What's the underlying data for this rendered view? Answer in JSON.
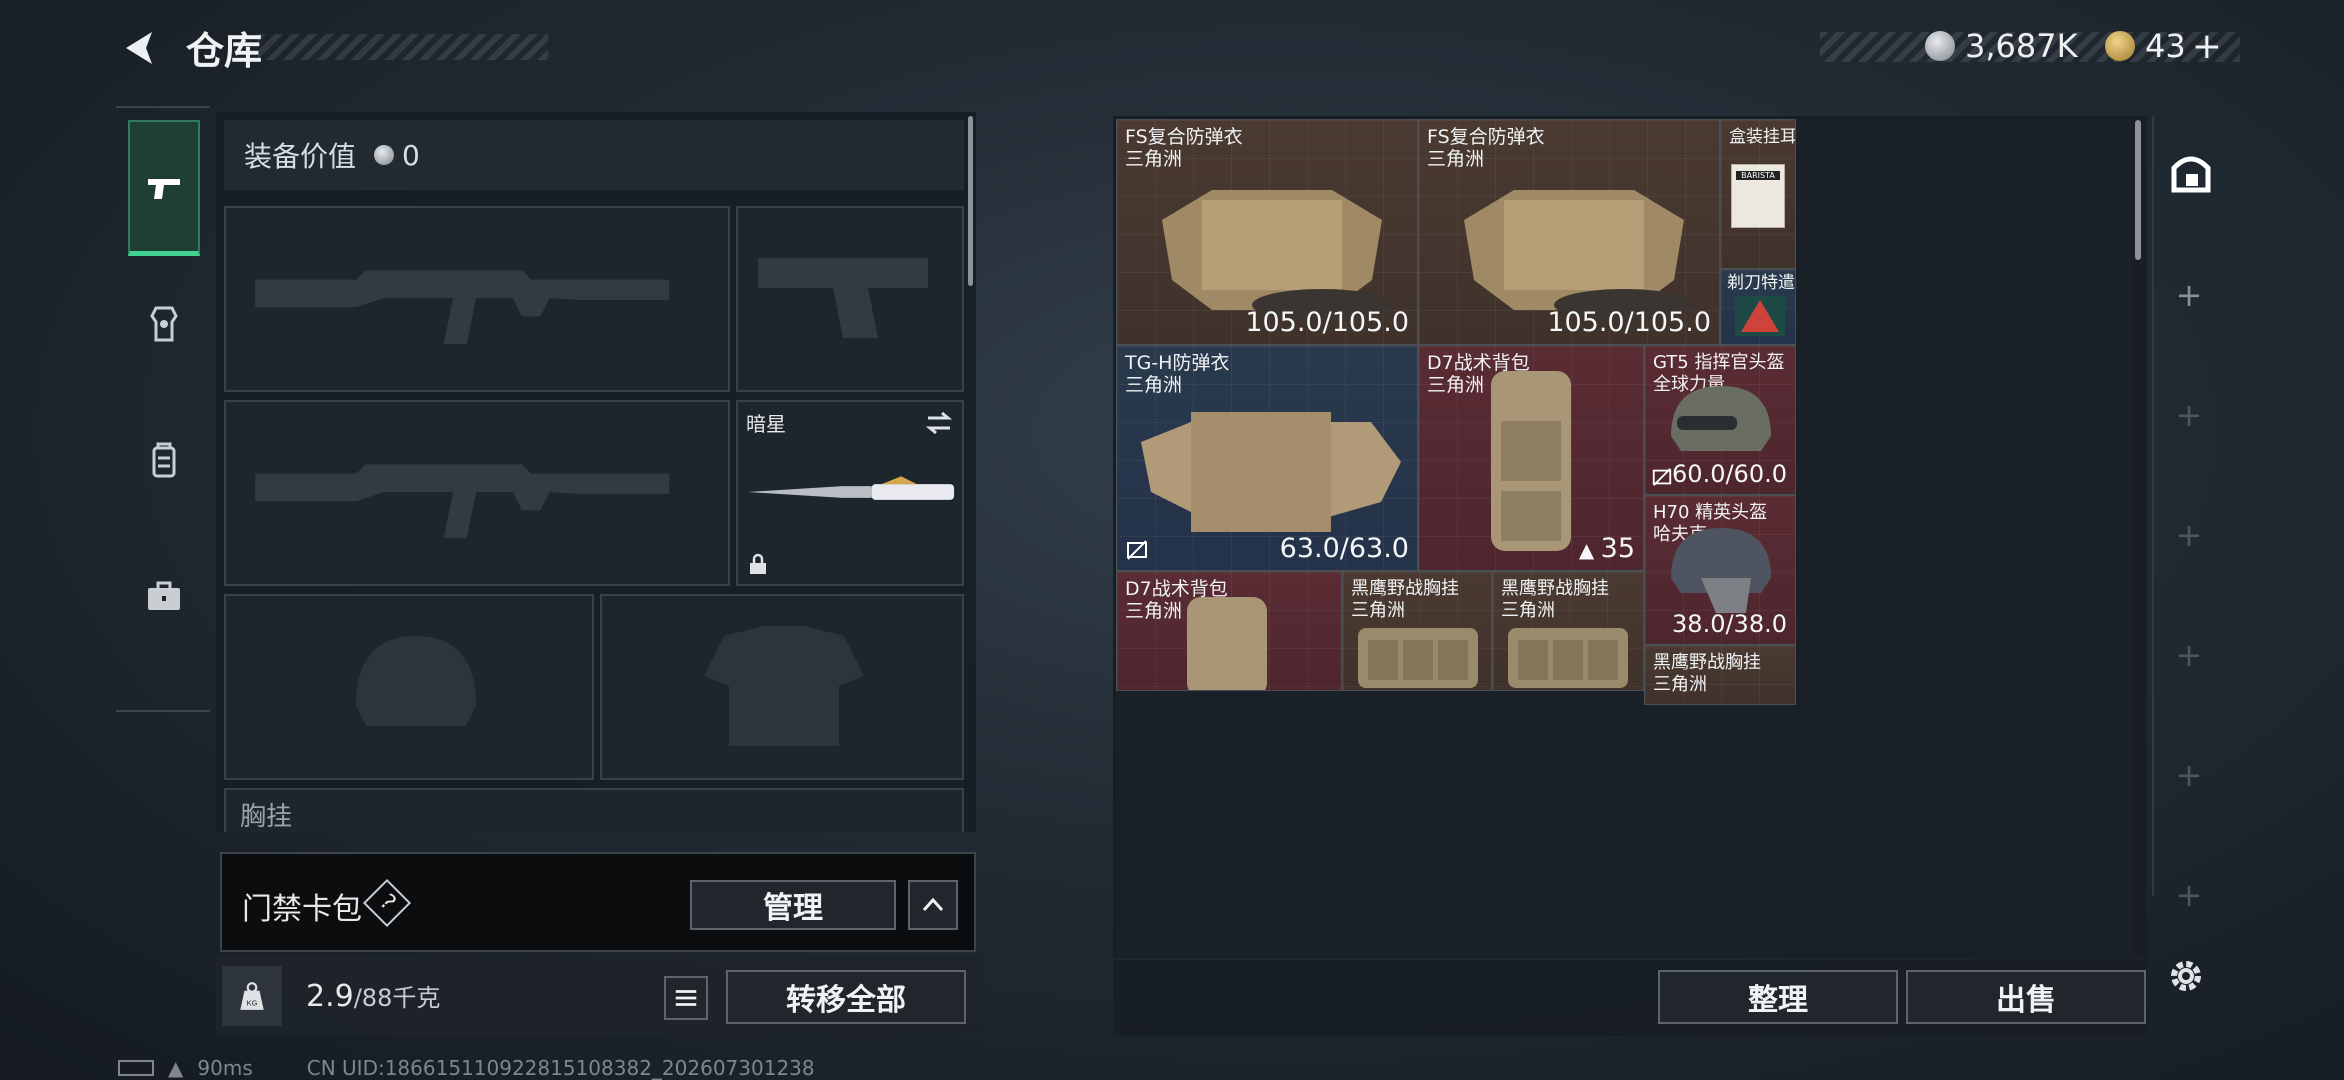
{
  "header": {
    "title": "仓库"
  },
  "currency": {
    "coins": "3,687K",
    "tokens": "43",
    "plus": "+"
  },
  "equipment": {
    "value_label": "装备价值",
    "value": "0",
    "melee_name": "暗星",
    "chest_label": "胸挂"
  },
  "gate_pack": {
    "label": "门禁卡包",
    "help": "?",
    "manage_label": "管理"
  },
  "weight": {
    "current": "2.9",
    "max": "/88千克",
    "transfer_all_label": "转移全部"
  },
  "stash_items": [
    {
      "name": "FS复合防弹衣",
      "sub": "三角洲",
      "durability": "105.0/105.0"
    },
    {
      "name": "FS复合防弹衣",
      "sub": "三角洲",
      "durability": "105.0/105.0"
    },
    {
      "name": "盒装挂耳…",
      "sub": ""
    },
    {
      "name": "剃刀特遣队",
      "sub": ""
    },
    {
      "name": "TG-H防弹衣",
      "sub": "三角洲",
      "durability": "63.0/63.0"
    },
    {
      "name": "D7战术背包",
      "sub": "三角洲",
      "durability": "35"
    },
    {
      "name": "GT5 指挥官头盔",
      "sub": "全球力量",
      "durability": "60.0/60.0"
    },
    {
      "name": "H70 精英头盔",
      "sub": "哈夫克",
      "durability": "38.0/38.0"
    },
    {
      "name": "D7战术背包",
      "sub": "三角洲"
    },
    {
      "name": "黑鹰野战胸挂",
      "sub": "三角洲"
    },
    {
      "name": "黑鹰野战胸挂",
      "sub": "三角洲"
    },
    {
      "name": "黑鹰野战胸挂",
      "sub": "三角洲"
    }
  ],
  "product_label": "BARISTA",
  "stash_buttons": {
    "sort_label": "整理",
    "sell_label": "出售"
  },
  "status": {
    "ping": "90ms",
    "uid": "CN UID:186615110922815108382_202607301238"
  }
}
